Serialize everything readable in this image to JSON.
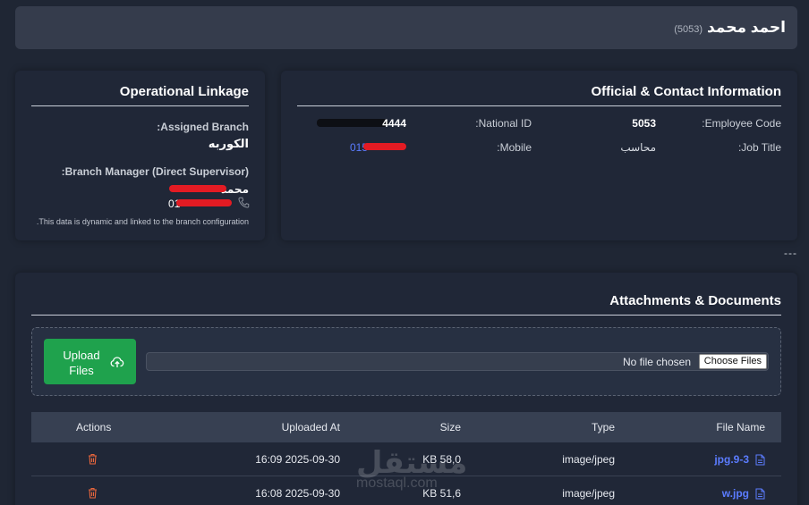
{
  "header": {
    "name": "احمد محمد",
    "code": "(5053)"
  },
  "official": {
    "title": "Official & Contact Information",
    "employee_code_label": "Employee Code:",
    "employee_code": "5053",
    "national_id_label": "National ID:",
    "national_id": "4444",
    "job_title_label": "Job Title:",
    "job_title": "محاسب",
    "mobile_label": "Mobile:",
    "mobile": "015"
  },
  "linkage": {
    "title": "Operational Linkage",
    "branch_label": "Assigned Branch:",
    "branch": "الكوربه",
    "manager_label": "Branch Manager (Direct Supervisor):",
    "manager_name": "محمد",
    "manager_phone": "01",
    "note": "This data is dynamic and linked to the branch configuration."
  },
  "separator": "---",
  "attachments": {
    "title": "Attachments & Documents",
    "upload_label": "Upload Files",
    "no_file": "No file chosen",
    "choose_files": "Choose Files",
    "columns": [
      "File Name",
      "Type",
      "Size",
      "Uploaded At",
      "Actions"
    ],
    "rows": [
      {
        "name": "jpg.9-3",
        "type": "image/jpeg",
        "size": "58,0 KB",
        "uploaded": "2025-09-30 16:09"
      },
      {
        "name": "w.jpg",
        "type": "image/jpeg",
        "size": "51,6 KB",
        "uploaded": "2025-09-30 16:08"
      }
    ]
  },
  "watermark": {
    "arabic": "مستقل",
    "latin": "mostaql.com"
  },
  "colors": {
    "accent_blue": "#5b7cff",
    "upload_green": "#1fa24d",
    "delete_red": "#e8663c",
    "redaction_red": "#e31b23"
  }
}
